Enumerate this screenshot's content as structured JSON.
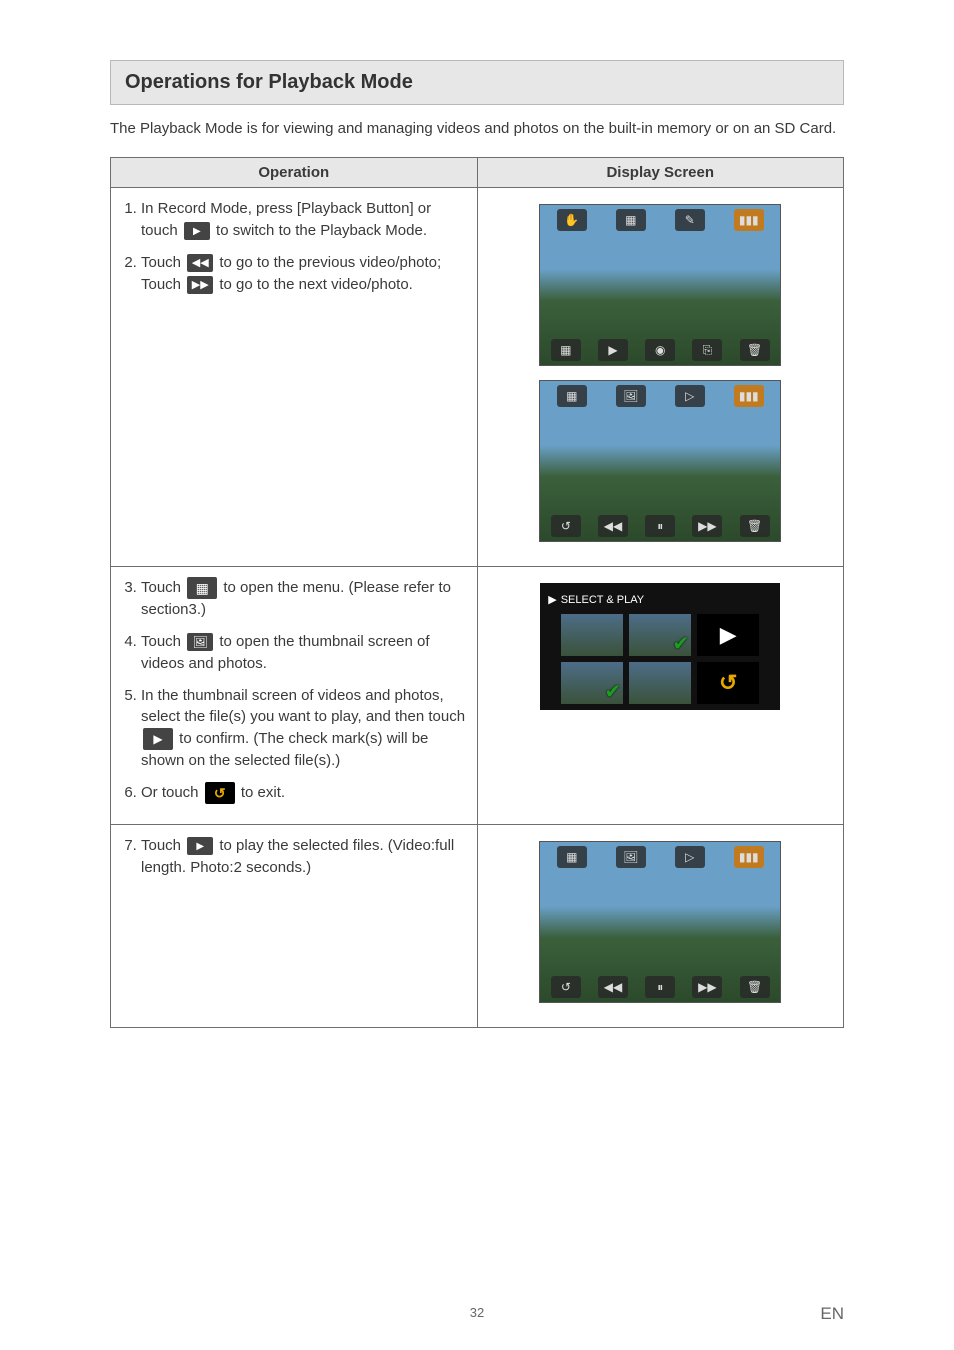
{
  "section_title": "Operations for Playback Mode",
  "intro": "The Playback Mode is for viewing and managing videos and photos on the built-in memory or on an SD Card.",
  "table": {
    "header_op": "Operation",
    "header_ds": "Display Screen"
  },
  "row1": {
    "li1_a": "In Record Mode, press [Playback Button] or touch ",
    "li1_b": " to switch to the Playback Mode.",
    "li2_a": "Touch ",
    "li2_b": " to go to the previous video/photo; Touch ",
    "li2_c": " to go to the next video/photo."
  },
  "row2": {
    "li3_a": "Touch ",
    "li3_b": " to open the menu. (Please refer to section3.)",
    "li4_a": "Touch ",
    "li4_b": " to open the thumbnail screen of videos and photos.",
    "li5_a": "In the thumbnail screen of videos and photos, select the file(s) you want to play, and then touch ",
    "li5_b": " to confirm. (The check mark(s) will be shown on the selected file(s).)",
    "li6_a": "Or touch ",
    "li6_b": " to exit.",
    "selectplay_title": "SELECT & PLAY"
  },
  "row3": {
    "li7_a": "Touch ",
    "li7_b": " to play the selected files. (Video:full length. Photo:2 seconds.)"
  },
  "icons": {
    "play": "play-icon",
    "prev": "prev-icon",
    "next": "next-icon",
    "menu": "menu-icon",
    "thumbs": "thumbs-icon",
    "confirm": "confirm-play-icon",
    "back": "back-icon"
  },
  "page_number": "32",
  "lang": "EN"
}
